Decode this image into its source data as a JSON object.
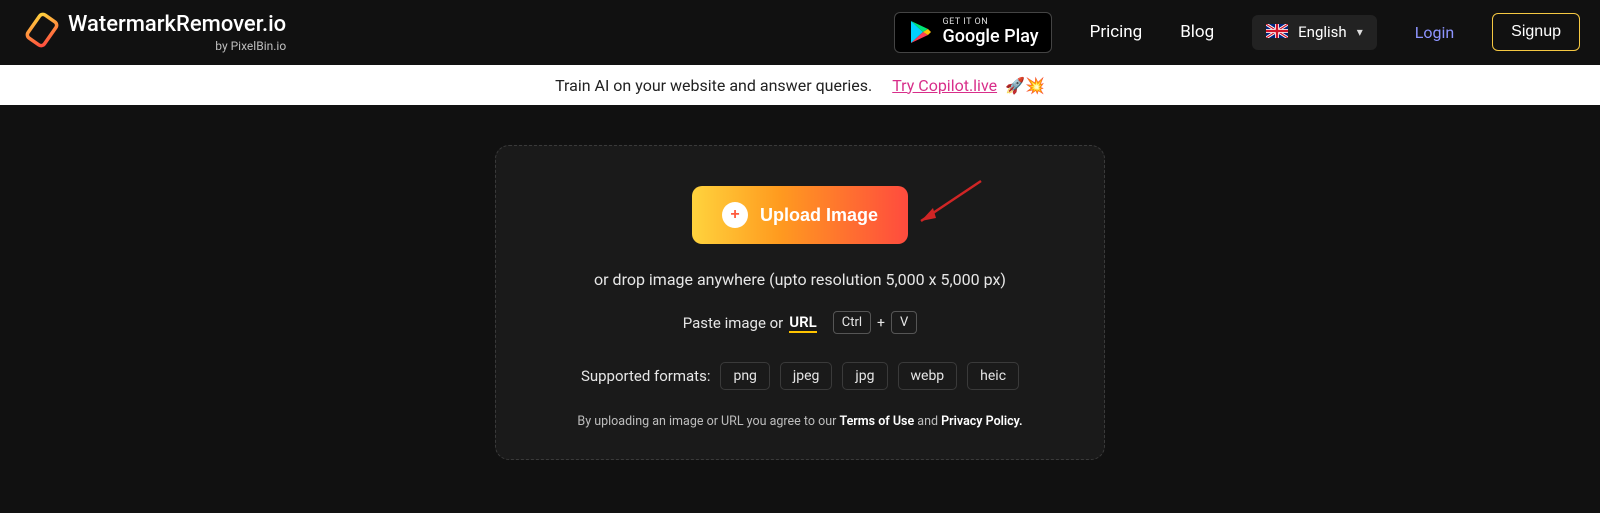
{
  "header": {
    "logo_title": "WatermarkRemover.io",
    "logo_subtitle": "by PixelBin.io",
    "google_play": {
      "small": "GET IT ON",
      "big": "Google Play"
    },
    "nav": {
      "pricing": "Pricing",
      "blog": "Blog"
    },
    "language": {
      "label": "English"
    },
    "login": "Login",
    "signup": "Signup"
  },
  "promo": {
    "text": "Train AI on your website and answer queries.",
    "link": "Try Copilot.live",
    "emojis": "🚀💥"
  },
  "panel": {
    "upload_label": "Upload Image",
    "drop_hint": "or drop image anywhere (upto resolution 5,000 x 5,000 px)",
    "paste_prefix": "Paste image or",
    "url_label": "URL",
    "kbd_ctrl": "Ctrl",
    "kbd_plus": "+",
    "kbd_v": "V",
    "formats_label": "Supported formats:",
    "formats": [
      "png",
      "jpeg",
      "jpg",
      "webp",
      "heic"
    ],
    "disclaimer_prefix": "By uploading an image or URL you agree to our ",
    "terms": "Terms of Use",
    "disclaimer_mid": " and ",
    "privacy": "Privacy Policy."
  }
}
